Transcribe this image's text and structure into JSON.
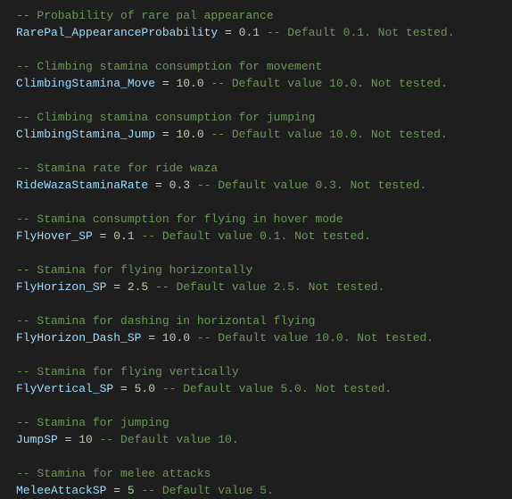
{
  "lines": [
    {
      "type": "comment",
      "text": "-- Probability of rare pal appearance"
    },
    {
      "type": "assign",
      "ident": "RarePal_AppearanceProbability",
      "eq": " = ",
      "value": "0.1",
      "trail": " -- Default 0.1. Not tested."
    },
    {
      "type": "blank"
    },
    {
      "type": "comment",
      "text": "-- Climbing stamina consumption for movement"
    },
    {
      "type": "assign",
      "ident": "ClimbingStamina_Move",
      "eq": " = ",
      "value": "10.0",
      "trail": " -- Default value 10.0. Not tested."
    },
    {
      "type": "blank"
    },
    {
      "type": "comment",
      "text": "-- Climbing stamina consumption for jumping"
    },
    {
      "type": "assign",
      "ident": "ClimbingStamina_Jump",
      "eq": " = ",
      "value": "10.0",
      "trail": " -- Default value 10.0. Not tested."
    },
    {
      "type": "blank"
    },
    {
      "type": "comment",
      "text": "-- Stamina rate for ride waza"
    },
    {
      "type": "assign",
      "ident": "RideWazaStaminaRate",
      "eq": " = ",
      "value": "0.3",
      "trail": " -- Default value 0.3. Not tested."
    },
    {
      "type": "blank"
    },
    {
      "type": "comment",
      "text": "-- Stamina consumption for flying in hover mode"
    },
    {
      "type": "assign",
      "ident": "FlyHover_SP",
      "eq": " = ",
      "value": "0.1",
      "trail": " -- Default value 0.1. Not tested."
    },
    {
      "type": "blank"
    },
    {
      "type": "comment",
      "text": "-- Stamina for flying horizontally"
    },
    {
      "type": "assign",
      "ident": "FlyHorizon_SP",
      "eq": " = ",
      "value": "2.5",
      "trail": " -- Default value 2.5. Not tested."
    },
    {
      "type": "blank"
    },
    {
      "type": "comment",
      "text": "-- Stamina for dashing in horizontal flying"
    },
    {
      "type": "assign",
      "ident": "FlyHorizon_Dash_SP",
      "eq": " = ",
      "value": "10.0",
      "trail": " -- Default value 10.0. Not tested."
    },
    {
      "type": "blank"
    },
    {
      "type": "comment",
      "text": "-- Stamina for flying vertically"
    },
    {
      "type": "assign",
      "ident": "FlyVertical_SP",
      "eq": " = ",
      "value": "5.0",
      "trail": " -- Default value 5.0. Not tested."
    },
    {
      "type": "blank"
    },
    {
      "type": "comment",
      "text": "-- Stamina for jumping"
    },
    {
      "type": "assign",
      "ident": "JumpSP",
      "eq": " = ",
      "value": "10",
      "trail": " -- Default value 10."
    },
    {
      "type": "blank"
    },
    {
      "type": "comment",
      "text": "-- Stamina for melee attacks"
    },
    {
      "type": "assign",
      "ident": "MeleeAttackSP",
      "eq": " = ",
      "value": "5",
      "trail": " -- Default value 5."
    }
  ]
}
